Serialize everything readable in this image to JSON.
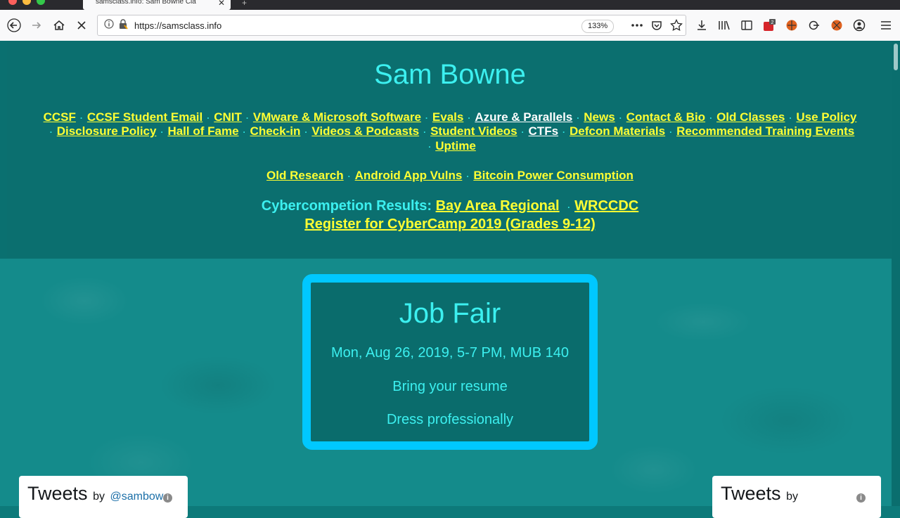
{
  "browser": {
    "tab_title": "samsclass.info: Sam Bowne Cla",
    "tab_close": "✕",
    "new_tab": "+",
    "url": "https://samsclass.info",
    "zoom": "133%",
    "toolbar_icons": [
      "back-icon",
      "forward-icon",
      "home-icon",
      "stop-loading-icon",
      "site-info-icon",
      "lock-icon",
      "more-actions-icon",
      "pocket-icon",
      "bookmark-star-icon",
      "download-icon",
      "library-icon",
      "sidebar-icon",
      "extension-badge-icon",
      "extension-icon",
      "extension-icon",
      "extension-icon",
      "account-icon",
      "menu-icon"
    ],
    "extension_badge": "2"
  },
  "page": {
    "title": "Sam Bowne",
    "nav_row1": [
      "CCSF",
      "CCSF Student Email",
      "CNIT",
      "VMware & Microsoft Software",
      "Evals",
      "Azure & Parallels",
      "News",
      "Contact & Bio",
      "Old Classes",
      "Use Policy"
    ],
    "nav_row2": [
      "Disclosure Policy",
      "Hall of Fame",
      "Check-in",
      "Videos & Podcasts",
      "Student Videos",
      "CTFs",
      "Defcon Materials",
      "Recommended Training Events"
    ],
    "nav_row3": [
      "Uptime"
    ],
    "research_links": [
      "Old Research",
      "Android App Vulns",
      "Bitcoin Power Consumption"
    ],
    "competition_label": "Cybercompetion Results:",
    "competition_links": [
      "Bay Area Regional",
      "WRCCDC"
    ],
    "cybercamp_link": "Register for CyberCamp 2019 (Grades 9-12)",
    "separator": "·",
    "colors": {
      "link": "#ffff33",
      "accent": "#3cf0f0",
      "card_border": "#00c8ff",
      "background": "#0a7070"
    }
  },
  "job_fair": {
    "title": "Job Fair",
    "when": "Mon, Aug 26, 2019, 5-7 PM, MUB 140",
    "line2": "Bring your resume",
    "line3": "Dress professionally"
  },
  "tweets_left": {
    "title": "Tweets",
    "by": "by",
    "handle": "@sambow"
  },
  "tweets_right": {
    "title": "Tweets",
    "by": "by"
  }
}
